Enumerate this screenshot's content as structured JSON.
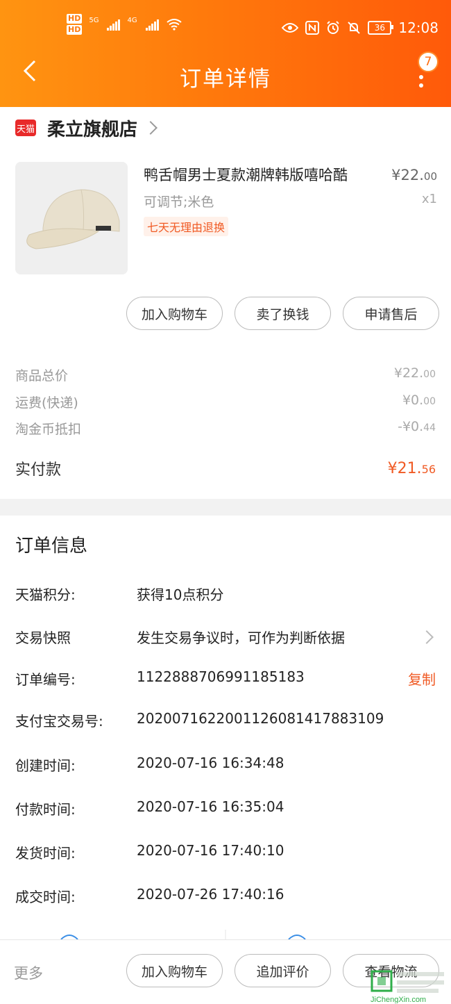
{
  "status": {
    "hd1": "HD",
    "hd2": "HD",
    "sig1": "5G",
    "sig2": "4G",
    "battery": "36",
    "time": "12:08"
  },
  "nav": {
    "title": "订单详情",
    "badge": "7"
  },
  "shop": {
    "logo": "天猫",
    "name": "柔立旗舰店"
  },
  "product": {
    "title": "鸭舌帽男士夏款潮牌韩版嘻哈酷",
    "spec": "可调节;米色",
    "tag": "七天无理由退换",
    "price_int": "¥22.",
    "price_dec": "00",
    "qty": "x1"
  },
  "actions": [
    "加入购物车",
    "卖了换钱",
    "申请售后"
  ],
  "fees": [
    {
      "label": "商品总价",
      "int": "¥22.",
      "dec": "00"
    },
    {
      "label": "运费(快递)",
      "int": "¥0.",
      "dec": "00"
    },
    {
      "label": "淘金币抵扣",
      "int": "-¥0.",
      "dec": "44"
    }
  ],
  "paid": {
    "label": "实付款",
    "int": "¥21.",
    "dec": "56"
  },
  "order_info": {
    "title": "订单信息",
    "rows": [
      {
        "key": "天猫积分:",
        "value": "获得10点积分"
      },
      {
        "key": "交易快照",
        "value": "发生交易争议时，可作为判断依据"
      },
      {
        "key": "订单编号:",
        "value": "1122888706991185183",
        "action": "复制"
      },
      {
        "key": "支付宝交易号:",
        "value": "2020071622001126081417883109"
      },
      {
        "key": "创建时间:",
        "value": "2020-07-16 16:34:48"
      },
      {
        "key": "付款时间:",
        "value": "2020-07-16 16:35:04"
      },
      {
        "key": "发货时间:",
        "value": "2020-07-16 17:40:10"
      },
      {
        "key": "成交时间:",
        "value": "2020-07-26 17:40:16"
      }
    ]
  },
  "bottom": {
    "more": "更多",
    "buttons": [
      "加入购物车",
      "追加评价",
      "查看物流"
    ]
  },
  "watermark": {
    "text": "JiChengXin.com"
  },
  "colors": {
    "brand": "#ff7a0c",
    "accent": "#f05a24"
  }
}
